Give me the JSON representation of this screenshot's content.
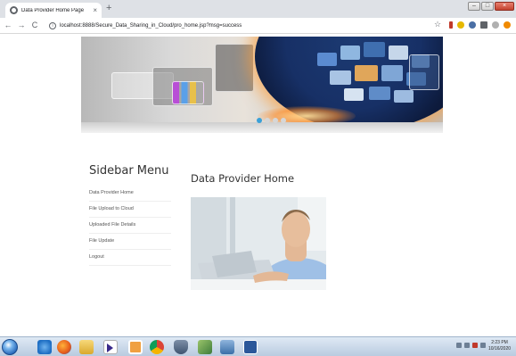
{
  "browser": {
    "tab_title": "Data Provider Home Page",
    "tab_close": "×",
    "new_tab": "+",
    "back": "←",
    "forward": "→",
    "reload": "C",
    "url": "localhost:8888/Secure_Data_Sharing_in_Cloud/pro_home.jsp?msg=success",
    "info_glyph": "i",
    "star": "☆",
    "win_minimize": "–",
    "win_maximize": "□",
    "win_close": "×"
  },
  "sidebar": {
    "title": "Sidebar Menu",
    "items": [
      {
        "label": "Data Provider Home"
      },
      {
        "label": "File Upload to Cloud"
      },
      {
        "label": "Uploaded File Details"
      },
      {
        "label": "File Update"
      },
      {
        "label": "Logout"
      }
    ]
  },
  "main": {
    "title": "Data Provider Home"
  },
  "taskbar": {
    "time": "2:23 PM",
    "date": "10/16/2020"
  },
  "colors": {
    "accent": "#3aa0d8",
    "text_dark": "#333333",
    "menu_text": "#555555"
  }
}
